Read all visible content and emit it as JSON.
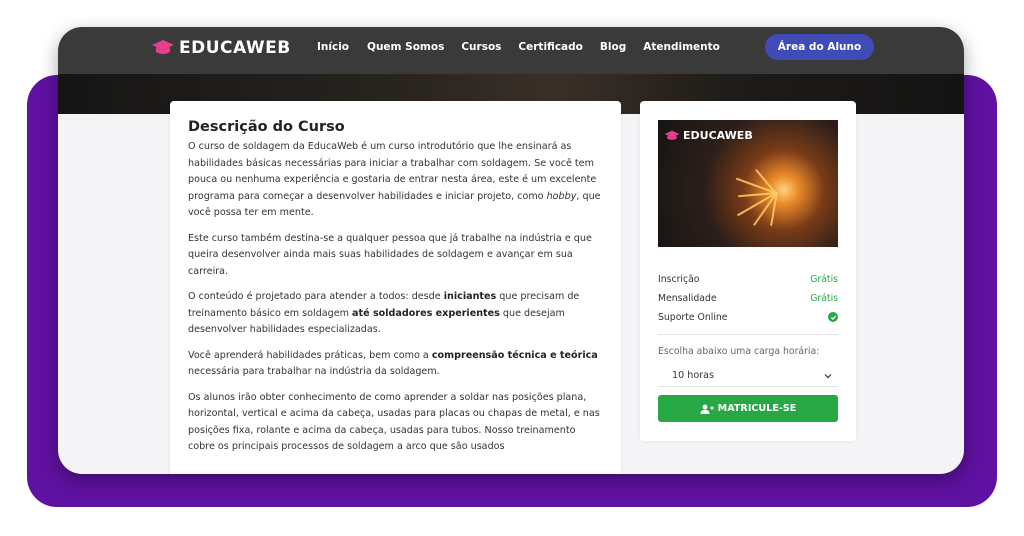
{
  "brand": {
    "name": "EDUCAWEB",
    "accent": "#e83e8c"
  },
  "nav": {
    "links": [
      "Início",
      "Quem Somos",
      "Cursos",
      "Certificado",
      "Blog",
      "Atendimento"
    ],
    "cta": "Área do Aluno"
  },
  "description": {
    "title": "Descrição do Curso",
    "p1_a": "O curso de soldagem da EducaWeb é um curso introdutório que lhe ensinará as habilidades básicas necessárias para iniciar a trabalhar com soldagem. Se você tem pouca ou nenhuma experiência e gostaria de entrar nesta área, este é um excelente programa para começar a desenvolver habilidades e iniciar projeto, como ",
    "p1_em": "hobby",
    "p1_b": ", que você possa ter em mente.",
    "p2": "Este curso também destina-se a qualquer pessoa que já trabalhe na indústria e que queira desenvolver ainda mais suas habilidades de soldagem e avançar em sua carreira.",
    "p3_a": "O conteúdo é projetado para atender a todos: desde ",
    "p3_b1": "iniciantes",
    "p3_c": " que precisam de treinamento básico em soldagem ",
    "p3_b2": "até soldadores experientes",
    "p3_d": " que desejam desenvolver habilidades especializadas.",
    "p4_a": "Você aprenderá habilidades práticas, bem como a ",
    "p4_b": "compreensão técnica e teórica",
    "p4_c": " necessária para trabalhar na indústria da soldagem.",
    "p5": "Os alunos irão obter conhecimento de como aprender a soldar nas posições plana, horizontal, vertical e acima da cabeça, usadas para placas ou chapas de metal, e nas posições fixa, rolante e acima da cabeça, usadas para tubos. Nosso treinamento cobre os principais processos de soldagem a arco que são usados"
  },
  "sidebar": {
    "image_logo": "EDUCAWEB",
    "inscricao_label": "Inscrição",
    "inscricao_value": "Grátis",
    "mensalidade_label": "Mensalidade",
    "mensalidade_value": "Grátis",
    "suporte_label": "Suporte Online",
    "suporte_icon": "check-circle-icon",
    "choose_label": "Escolha abaixo uma carga horária:",
    "select_value": "10 horas",
    "enroll_label": "MATRICULE-SE",
    "enroll_icon": "user-plus-icon",
    "green": "#28a745"
  }
}
